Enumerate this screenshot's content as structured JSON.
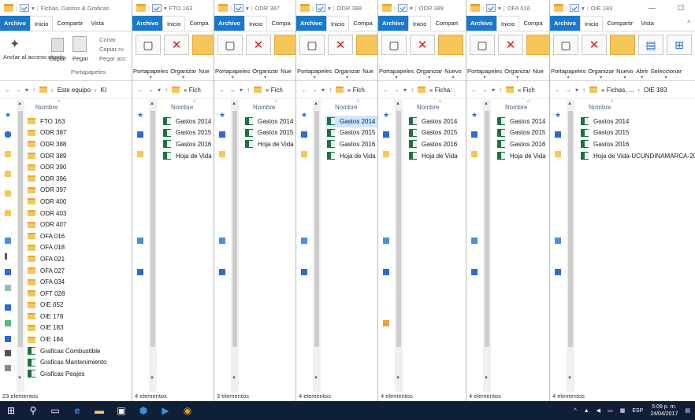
{
  "windows": [
    {
      "title_text": "Fichas, Gastos & Graficas",
      "tabs": [
        "Archivo",
        "Inicio",
        "Compartir",
        "Vista"
      ],
      "ribbon": {
        "pin": "Anclar al acceso rápido",
        "copy": "Copiar",
        "paste": "Pegar",
        "cut": "Cortar",
        "copy_route": "Copiar ru",
        "paste_access": "Pegar acc",
        "group": "Portapapeles"
      },
      "address": [
        "Este equipo",
        "KI"
      ],
      "column": "Nombre",
      "items": [
        {
          "name": "FTO 163",
          "type": "folder"
        },
        {
          "name": "ODR 387",
          "type": "folder"
        },
        {
          "name": "ODR 388",
          "type": "folder"
        },
        {
          "name": "ODR 389",
          "type": "folder"
        },
        {
          "name": "ODR 390",
          "type": "folder"
        },
        {
          "name": "ODR 396",
          "type": "folder"
        },
        {
          "name": "ODR 397",
          "type": "folder"
        },
        {
          "name": "ODR 400",
          "type": "folder"
        },
        {
          "name": "ODR 403",
          "type": "folder"
        },
        {
          "name": "ODR 407",
          "type": "folder"
        },
        {
          "name": "OFA 016",
          "type": "folder"
        },
        {
          "name": "OFA 018",
          "type": "folder"
        },
        {
          "name": "OFA 021",
          "type": "folder"
        },
        {
          "name": "OFA 027",
          "type": "folder"
        },
        {
          "name": "OFA 034",
          "type": "folder"
        },
        {
          "name": "OFT 028",
          "type": "folder"
        },
        {
          "name": "OIE 052",
          "type": "folder"
        },
        {
          "name": "OIE 178",
          "type": "folder"
        },
        {
          "name": "OIE 183",
          "type": "folder"
        },
        {
          "name": "OIE 184",
          "type": "folder"
        },
        {
          "name": "Graficas Combustible",
          "type": "xls"
        },
        {
          "name": "Graficas Mantenimiento",
          "type": "xls"
        },
        {
          "name": "Graficas Peajes",
          "type": "xls"
        }
      ],
      "status": "23 elementos"
    },
    {
      "title_text": "FTO 163",
      "tabs": [
        "Archivo",
        "Inicio",
        "Compa"
      ],
      "ribbon_labels": [
        "Portapapeles",
        "Organizar",
        "Nue"
      ],
      "address": [
        "« Fich"
      ],
      "column": "Nombre",
      "items": [
        {
          "name": "Gastos 2014",
          "type": "xls"
        },
        {
          "name": "Gastos 2015",
          "type": "xls"
        },
        {
          "name": "Gastos 2016",
          "type": "xls"
        },
        {
          "name": "Hoja de Vida",
          "type": "xls"
        }
      ],
      "status": "4 elementos"
    },
    {
      "title_text": "ODR 387",
      "tabs": [
        "Archivo",
        "Inicio",
        "Compa"
      ],
      "ribbon_labels": [
        "Portapapeles",
        "Organizar",
        "Nue"
      ],
      "address": [
        "« Fich"
      ],
      "column": "Nombre",
      "items": [
        {
          "name": "Gastos 2014",
          "type": "xls"
        },
        {
          "name": "Gastos 2015",
          "type": "xls"
        },
        {
          "name": "Hoja de Vida",
          "type": "xls"
        }
      ],
      "status": "3 elementos"
    },
    {
      "title_text": "ODR 388",
      "tabs": [
        "Archivo",
        "Inicio",
        "Compa"
      ],
      "ribbon_labels": [
        "Portapapeles",
        "Organizar",
        "Nue"
      ],
      "address": [
        "« Fich"
      ],
      "column": "Nombre",
      "items": [
        {
          "name": "Gastos 2014",
          "type": "xls"
        },
        {
          "name": "Gastos 2015",
          "type": "xls"
        },
        {
          "name": "Gastos 2016",
          "type": "xls"
        },
        {
          "name": "Hoja de Vida",
          "type": "xls"
        }
      ],
      "status": "4 elementos"
    },
    {
      "title_text": "ODR 389",
      "tabs": [
        "Archivo",
        "Inicio",
        "Compart"
      ],
      "ribbon_labels": [
        "Portapapeles",
        "Organizar",
        "Nuevo"
      ],
      "address": [
        "« Ficha:"
      ],
      "column": "Nombre",
      "items": [
        {
          "name": "Gastos 2014",
          "type": "xls"
        },
        {
          "name": "Gastos 2015",
          "type": "xls"
        },
        {
          "name": "Gastos 2016",
          "type": "xls"
        },
        {
          "name": "Hoja de Vida",
          "type": "xls"
        }
      ],
      "status": "4 elementos"
    },
    {
      "title_text": "OFA 016",
      "tabs": [
        "Archivo",
        "Inicio",
        "Compa"
      ],
      "ribbon_labels": [
        "Portapapeles",
        "Organizar",
        "Nue"
      ],
      "address": [
        "« Fich"
      ],
      "column": "Nombre",
      "items": [
        {
          "name": "Gastos 2014",
          "type": "xls"
        },
        {
          "name": "Gastos 2015",
          "type": "xls"
        },
        {
          "name": "Gastos 2016",
          "type": "xls"
        },
        {
          "name": "Hoja de Vida",
          "type": "xls"
        }
      ],
      "status": "4 elementos"
    },
    {
      "title_text": "OIE 183",
      "tabs": [
        "Archivo",
        "Inicio",
        "Compartir",
        "Vista"
      ],
      "ribbon_labels": [
        "Portapapeles",
        "Organizar",
        "Nuevo",
        "Abrir",
        "Seleccionar"
      ],
      "address": [
        "« Fichas, ...",
        "OIE 183"
      ],
      "column": "Nombre",
      "items": [
        {
          "name": "Gastos 2014",
          "type": "xls"
        },
        {
          "name": "Gastos 2015",
          "type": "xls"
        },
        {
          "name": "Gastos 2016",
          "type": "xls"
        },
        {
          "name": "Hoja de Vida-UCUNDINAMARCA-20",
          "type": "xls"
        }
      ],
      "status": "4 elementos"
    }
  ],
  "taskbar": {
    "time": "5:09 p. m.",
    "date": "24/04/2017",
    "lang": "ESP"
  },
  "colors": {
    "file_tab": "#1979ca",
    "taskbar": "#0f1f36",
    "folder": "#f7c65a",
    "excel": "#1e7145",
    "selection": "#cce8ff"
  }
}
